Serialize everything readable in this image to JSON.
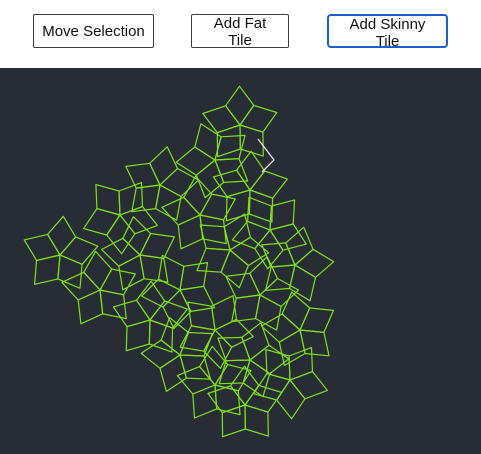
{
  "toolbar": {
    "move_label": "Move Selection",
    "fat_label": "Add Fat Tile",
    "skinny_label": "Add Skinny Tile"
  },
  "canvas": {
    "background": "#282c34",
    "tile_color": "#7fe01a",
    "selected_color": "#e8e8e8"
  }
}
